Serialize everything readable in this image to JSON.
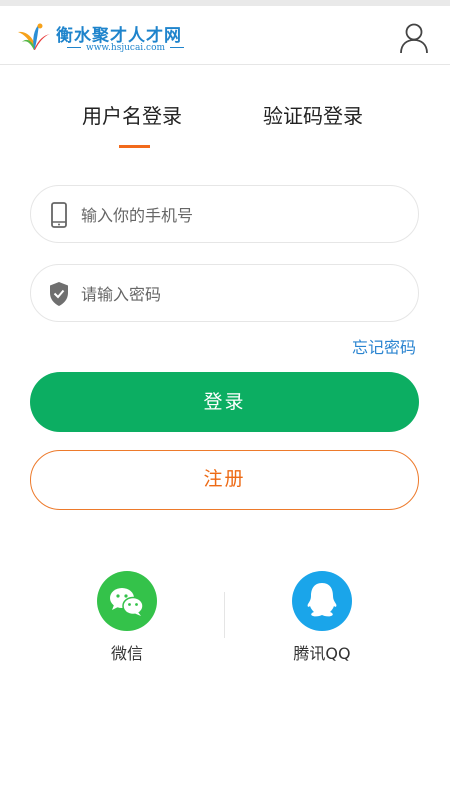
{
  "header": {
    "site_name": "衡水聚才人才网",
    "site_url": "www.hsjucai.com",
    "user_icon": "user-icon"
  },
  "tabs": [
    {
      "label": "用户名登录",
      "active": true
    },
    {
      "label": "验证码登录",
      "active": false
    }
  ],
  "form": {
    "phone_placeholder": "输入你的手机号",
    "password_placeholder": "请输入密码",
    "forgot_label": "忘记密码",
    "login_label": "登录",
    "register_label": "注册"
  },
  "social": [
    {
      "label": "微信",
      "icon": "wechat-icon",
      "color": "#34c24a"
    },
    {
      "label": "腾讯QQ",
      "icon": "qq-icon",
      "color": "#1aa5ea"
    }
  ],
  "colors": {
    "primary_green": "#0cae62",
    "accent_orange": "#f26a1b",
    "link_blue": "#2a84d0"
  }
}
